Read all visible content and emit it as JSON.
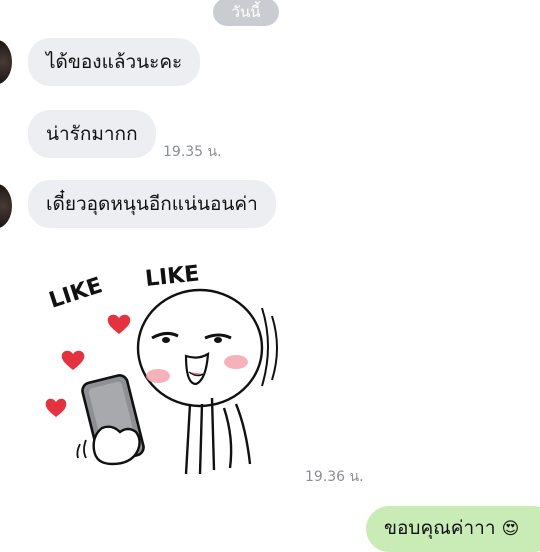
{
  "chat": {
    "date_label": "วันนี้",
    "messages": [
      {
        "side": "in",
        "text": "ได้ของแล้วนะคะ",
        "time": ""
      },
      {
        "side": "in",
        "text": "น่ารักมากก",
        "time": "19.35 น."
      },
      {
        "side": "in",
        "text": "เดี๋ยวอุดหนุนอีกแน่นอนค่า",
        "time": ""
      },
      {
        "side": "in",
        "type": "sticker",
        "sticker_text": [
          "LIKE",
          "LIKE"
        ],
        "time": "19.36 น."
      },
      {
        "side": "out",
        "text": "ขอบคุณค่าาา",
        "emoji": "😍"
      }
    ]
  },
  "colors": {
    "incoming_bubble": "#eceef1",
    "outgoing_bubble": "#c9ebb6",
    "heart": "#e5323f",
    "blush": "#f3a6ad"
  }
}
